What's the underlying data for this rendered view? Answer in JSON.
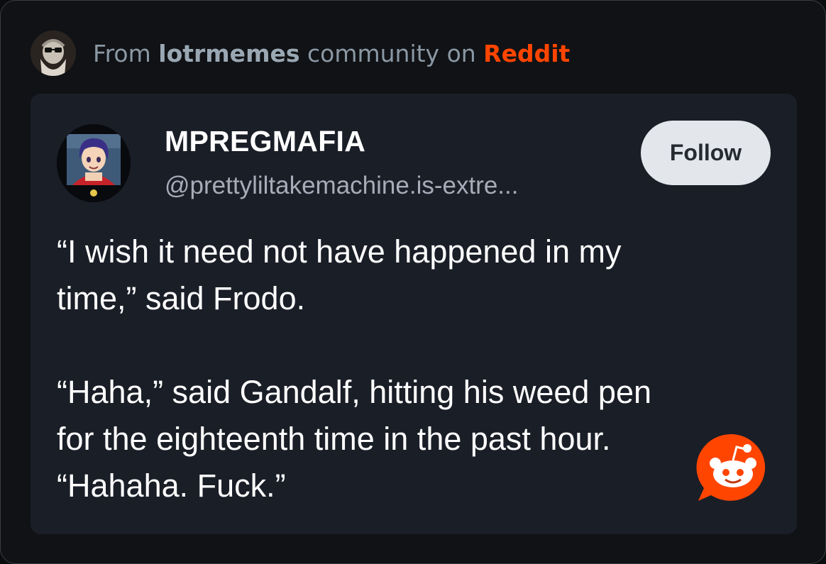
{
  "source": {
    "prefix": "From",
    "community": "lotrmemes",
    "middle": "community on",
    "platform": "Reddit",
    "avatar_icon": "community-avatar-wizard",
    "platform_color": "#ff4500"
  },
  "post": {
    "author": {
      "display_name": "MPREGMAFIA",
      "handle": "@prettyliltakemachine.is-extre...",
      "avatar_icon": "user-avatar-anime-character"
    },
    "follow_label": "Follow",
    "paragraphs": [
      "“I wish it need not have happened in my\ntime,” said Frodo.",
      "“Haha,” said Gandalf, hitting his weed pen\nfor the eighteenth time in the past hour.\n“Hahaha. Fuck.”"
    ]
  },
  "badge": {
    "icon": "reddit-snoo-icon",
    "color": "#ff4500"
  }
}
